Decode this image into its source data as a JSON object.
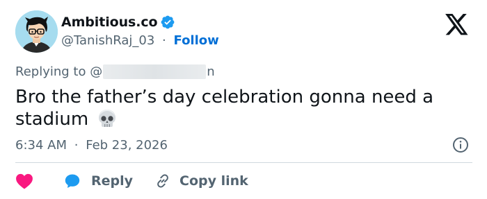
{
  "author": {
    "display_name": "Ambitious.co",
    "handle": "@TanishRaj_03",
    "separator": "·",
    "follow_label": "Follow",
    "verified_color": "#1d9bf0"
  },
  "reply_context": {
    "prefix": "Replying to @",
    "suffix": "n"
  },
  "tweet": {
    "text": "Bro the father’s day celebration gonna need a stadium",
    "emoji_icon": "skull-icon"
  },
  "meta": {
    "time": "6:34 AM",
    "separator": "·",
    "date": "Feb 23, 2026"
  },
  "actions": {
    "reply_label": "Reply",
    "copy_link_label": "Copy link"
  },
  "colors": {
    "accent": "#006fd6",
    "heart": "#f91880",
    "reply_bubble": "#1d9bf0",
    "muted_text": "#536471"
  }
}
